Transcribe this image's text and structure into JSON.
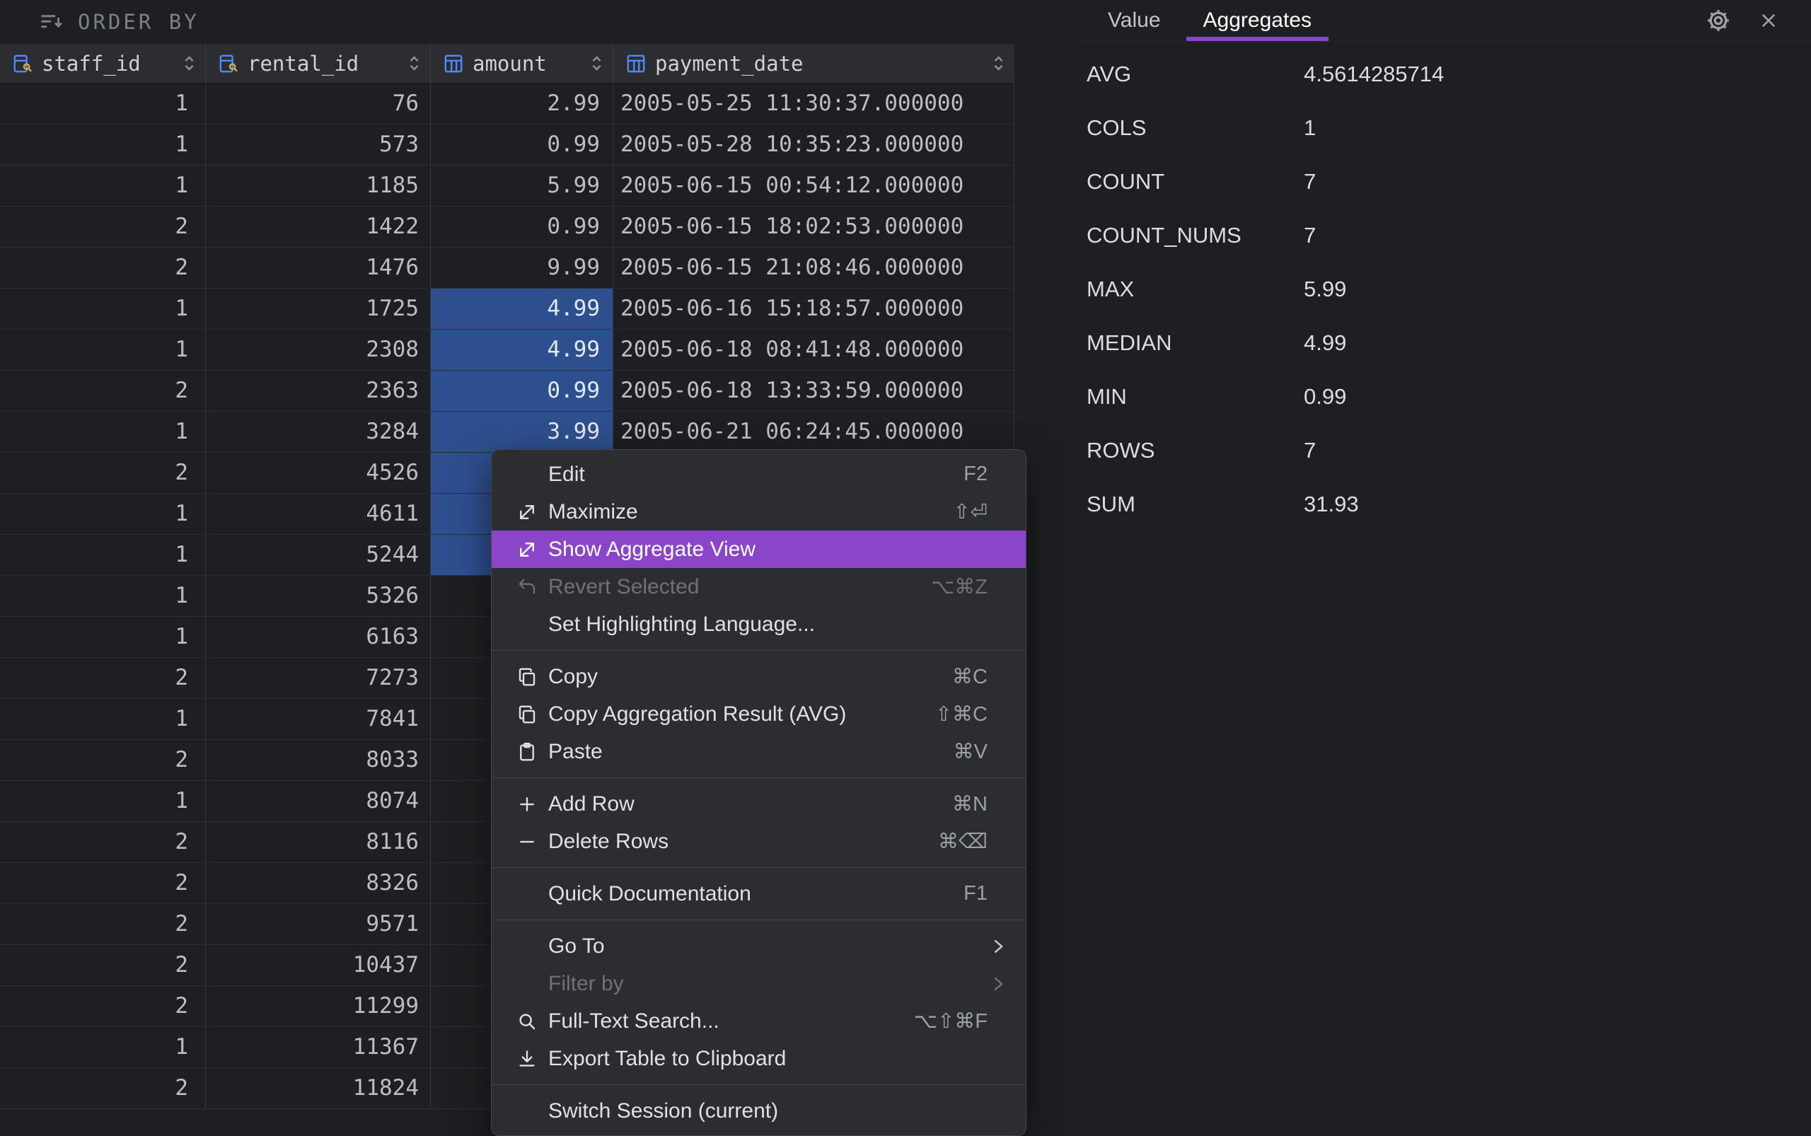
{
  "colors": {
    "accent": "#8A45C9",
    "selection": "#2E4F8E"
  },
  "topbar": {
    "label": "ORDER BY",
    "icon": "order-by-icon"
  },
  "table": {
    "columns": [
      {
        "label": "staff_id",
        "icon": "key-column-icon",
        "align": "right"
      },
      {
        "label": "rental_id",
        "icon": "key-column-icon",
        "align": "right"
      },
      {
        "label": "amount",
        "icon": "table-column-icon",
        "align": "right"
      },
      {
        "label": "payment_date",
        "icon": "table-column-icon",
        "align": "left"
      }
    ],
    "rows": [
      {
        "staff_id": "1",
        "rental_id": "76",
        "amount": "2.99",
        "payment_date": "2005-05-25 11:30:37.000000",
        "amount_selected": false
      },
      {
        "staff_id": "1",
        "rental_id": "573",
        "amount": "0.99",
        "payment_date": "2005-05-28 10:35:23.000000",
        "amount_selected": false
      },
      {
        "staff_id": "1",
        "rental_id": "1185",
        "amount": "5.99",
        "payment_date": "2005-06-15 00:54:12.000000",
        "amount_selected": false
      },
      {
        "staff_id": "2",
        "rental_id": "1422",
        "amount": "0.99",
        "payment_date": "2005-06-15 18:02:53.000000",
        "amount_selected": false
      },
      {
        "staff_id": "2",
        "rental_id": "1476",
        "amount": "9.99",
        "payment_date": "2005-06-15 21:08:46.000000",
        "amount_selected": false
      },
      {
        "staff_id": "1",
        "rental_id": "1725",
        "amount": "4.99",
        "payment_date": "2005-06-16 15:18:57.000000",
        "amount_selected": true
      },
      {
        "staff_id": "1",
        "rental_id": "2308",
        "amount": "4.99",
        "payment_date": "2005-06-18 08:41:48.000000",
        "amount_selected": true
      },
      {
        "staff_id": "2",
        "rental_id": "2363",
        "amount": "0.99",
        "payment_date": "2005-06-18 13:33:59.000000",
        "amount_selected": true
      },
      {
        "staff_id": "1",
        "rental_id": "3284",
        "amount": "3.99",
        "payment_date": "2005-06-21 06:24:45.000000",
        "amount_selected": true
      },
      {
        "staff_id": "2",
        "rental_id": "4526",
        "amount": null,
        "payment_date": null,
        "amount_selected": true
      },
      {
        "staff_id": "1",
        "rental_id": "4611",
        "amount": null,
        "payment_date": null,
        "amount_selected": true
      },
      {
        "staff_id": "1",
        "rental_id": "5244",
        "amount": null,
        "payment_date": null,
        "amount_selected": true
      },
      {
        "staff_id": "1",
        "rental_id": "5326",
        "amount": null,
        "payment_date": null,
        "amount_selected": false
      },
      {
        "staff_id": "1",
        "rental_id": "6163",
        "amount": null,
        "payment_date": null,
        "amount_selected": false
      },
      {
        "staff_id": "2",
        "rental_id": "7273",
        "amount": null,
        "payment_date": null,
        "amount_selected": false
      },
      {
        "staff_id": "1",
        "rental_id": "7841",
        "amount": null,
        "payment_date": null,
        "amount_selected": false
      },
      {
        "staff_id": "2",
        "rental_id": "8033",
        "amount": null,
        "payment_date": null,
        "amount_selected": false
      },
      {
        "staff_id": "1",
        "rental_id": "8074",
        "amount": null,
        "payment_date": null,
        "amount_selected": false
      },
      {
        "staff_id": "2",
        "rental_id": "8116",
        "amount": null,
        "payment_date": null,
        "amount_selected": false
      },
      {
        "staff_id": "2",
        "rental_id": "8326",
        "amount": null,
        "payment_date": null,
        "amount_selected": false
      },
      {
        "staff_id": "2",
        "rental_id": "9571",
        "amount": null,
        "payment_date": null,
        "amount_selected": false
      },
      {
        "staff_id": "2",
        "rental_id": "10437",
        "amount": null,
        "payment_date": null,
        "amount_selected": false
      },
      {
        "staff_id": "2",
        "rental_id": "11299",
        "amount": null,
        "payment_date": null,
        "amount_selected": false
      },
      {
        "staff_id": "1",
        "rental_id": "11367",
        "amount": null,
        "payment_date": null,
        "amount_selected": false
      },
      {
        "staff_id": "2",
        "rental_id": "11824",
        "amount": null,
        "payment_date": null,
        "amount_selected": false
      }
    ]
  },
  "context_menu": {
    "items": [
      {
        "type": "item",
        "label": "Edit",
        "shortcut": "F2",
        "icon": null,
        "enabled": true,
        "highlighted": false
      },
      {
        "type": "item",
        "label": "Maximize",
        "shortcut": "⇧⏎",
        "icon": "maximize-icon",
        "enabled": true,
        "highlighted": false
      },
      {
        "type": "item",
        "label": "Show Aggregate View",
        "shortcut": null,
        "icon": "aggregate-view-icon",
        "enabled": true,
        "highlighted": true
      },
      {
        "type": "item",
        "label": "Revert Selected",
        "shortcut": "⌥⌘Z",
        "icon": "revert-icon",
        "enabled": false,
        "highlighted": false
      },
      {
        "type": "item",
        "label": "Set Highlighting Language...",
        "shortcut": null,
        "icon": null,
        "enabled": true,
        "highlighted": false
      },
      {
        "type": "separator"
      },
      {
        "type": "item",
        "label": "Copy",
        "shortcut": "⌘C",
        "icon": "copy-icon",
        "enabled": true,
        "highlighted": false
      },
      {
        "type": "item",
        "label": "Copy Aggregation Result (AVG)",
        "shortcut": "⇧⌘C",
        "icon": "copy-icon",
        "enabled": true,
        "highlighted": false
      },
      {
        "type": "item",
        "label": "Paste",
        "shortcut": "⌘V",
        "icon": "paste-icon",
        "enabled": true,
        "highlighted": false
      },
      {
        "type": "separator"
      },
      {
        "type": "item",
        "label": "Add Row",
        "shortcut": "⌘N",
        "icon": "plus-icon",
        "enabled": true,
        "highlighted": false
      },
      {
        "type": "item",
        "label": "Delete Rows",
        "shortcut": "⌘⌫",
        "icon": "minus-icon",
        "enabled": true,
        "highlighted": false
      },
      {
        "type": "separator"
      },
      {
        "type": "item",
        "label": "Quick Documentation",
        "shortcut": "F1",
        "icon": null,
        "enabled": true,
        "highlighted": false
      },
      {
        "type": "separator"
      },
      {
        "type": "item",
        "label": "Go To",
        "shortcut": null,
        "icon": null,
        "enabled": true,
        "highlighted": false,
        "submenu": true
      },
      {
        "type": "item",
        "label": "Filter by",
        "shortcut": null,
        "icon": null,
        "enabled": false,
        "highlighted": false,
        "submenu": true
      },
      {
        "type": "item",
        "label": "Full-Text Search...",
        "shortcut": "⌥⇧⌘F",
        "icon": "search-icon",
        "enabled": true,
        "highlighted": false
      },
      {
        "type": "item",
        "label": "Export Table to Clipboard",
        "shortcut": null,
        "icon": "export-icon",
        "enabled": true,
        "highlighted": false
      },
      {
        "type": "separator"
      },
      {
        "type": "item",
        "label": "Switch Session (current)",
        "shortcut": null,
        "icon": null,
        "enabled": true,
        "highlighted": false
      }
    ]
  },
  "right_panel": {
    "tabs": [
      {
        "label": "Value",
        "active": false
      },
      {
        "label": "Aggregates",
        "active": true
      }
    ],
    "aggregates": [
      {
        "label": "AVG",
        "value": "4.5614285714"
      },
      {
        "label": "COLS",
        "value": "1"
      },
      {
        "label": "COUNT",
        "value": "7"
      },
      {
        "label": "COUNT_NUMS",
        "value": "7"
      },
      {
        "label": "MAX",
        "value": "5.99"
      },
      {
        "label": "MEDIAN",
        "value": "4.99"
      },
      {
        "label": "MIN",
        "value": "0.99"
      },
      {
        "label": "ROWS",
        "value": "7"
      },
      {
        "label": "SUM",
        "value": "31.93"
      }
    ]
  }
}
